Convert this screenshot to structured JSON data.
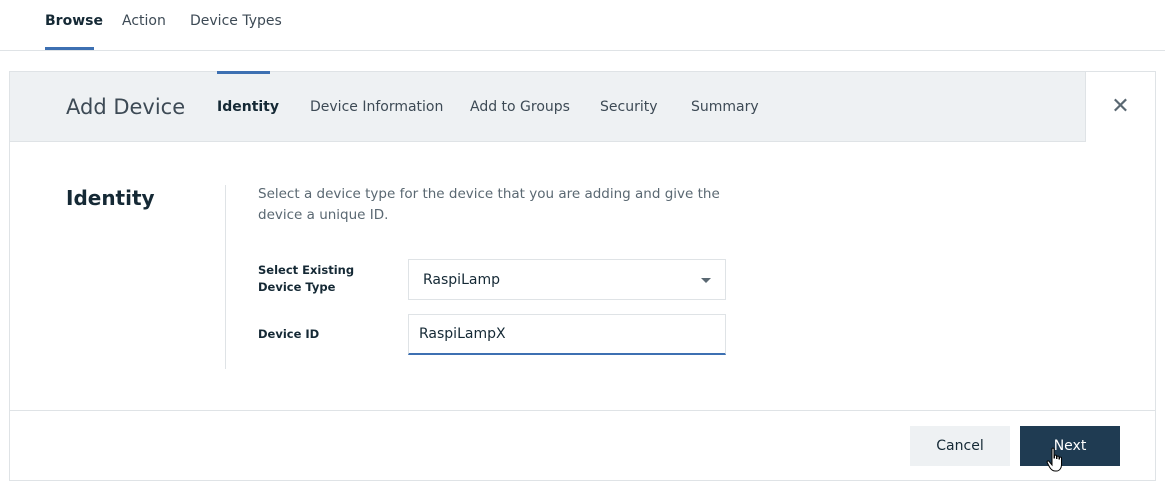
{
  "top_nav": {
    "tabs": [
      {
        "label": "Browse",
        "active": true
      },
      {
        "label": "Action",
        "active": false
      },
      {
        "label": "Device Types",
        "active": false
      }
    ]
  },
  "modal": {
    "title": "Add Device",
    "steps": [
      {
        "label": "Identity",
        "active": true
      },
      {
        "label": "Device Information",
        "active": false
      },
      {
        "label": "Add to Groups",
        "active": false
      },
      {
        "label": "Security",
        "active": false
      },
      {
        "label": "Summary",
        "active": false
      }
    ],
    "close_icon": "close-icon",
    "close_glyph": "✕"
  },
  "identity": {
    "section_title": "Identity",
    "description": "Select a device type for the device that you are adding and give the device a unique ID.",
    "device_type_label": "Select Existing Device Type",
    "device_type_value": "RaspiLamp",
    "device_id_label": "Device ID",
    "device_id_value": "RaspiLampX"
  },
  "footer": {
    "cancel_label": "Cancel",
    "next_label": "Next"
  },
  "colors": {
    "accent": "#3d70b2",
    "header_bg": "#eef1f3",
    "primary_button": "#1f3b52"
  }
}
